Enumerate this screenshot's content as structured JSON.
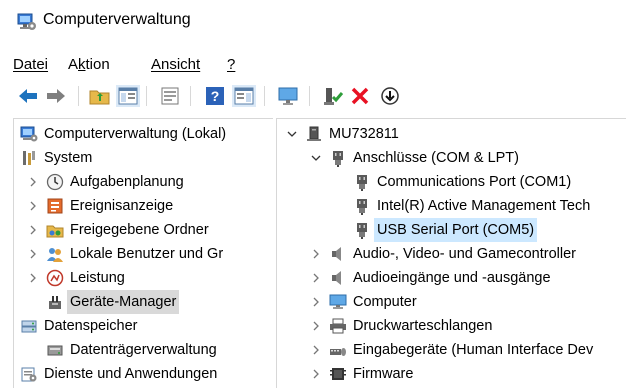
{
  "window": {
    "title": "Computerverwaltung"
  },
  "menu": [
    {
      "label": "Datei",
      "accel": "D"
    },
    {
      "label": "Aktion",
      "accel": "k"
    },
    {
      "label": "Ansicht",
      "accel": "A"
    },
    {
      "label": "?",
      "accel": "?"
    }
  ],
  "toolbar": [
    "back-arrow-icon",
    "forward-arrow-icon",
    "up-folder-icon",
    "show-hide-tree-icon",
    "properties-icon",
    "help-icon",
    "action-pane-icon",
    "monitor-icon",
    "enable-driver-icon",
    "delete-x-icon",
    "download-icon"
  ],
  "left_tree": [
    {
      "label": "Computerverwaltung (Lokal)",
      "level": 0,
      "chevron": "none",
      "icon": "computer-management-icon"
    },
    {
      "label": "System",
      "level": 0,
      "chevron": "open",
      "icon": "tools-icon"
    },
    {
      "label": "Aufgabenplanung",
      "level": 1,
      "chevron": "closed",
      "icon": "clock-icon"
    },
    {
      "label": "Ereignisanzeige",
      "level": 1,
      "chevron": "closed",
      "icon": "event-viewer-icon"
    },
    {
      "label": "Freigegebene Ordner",
      "level": 1,
      "chevron": "closed",
      "icon": "shared-folder-icon"
    },
    {
      "label": "Lokale Benutzer und Gr",
      "level": 1,
      "chevron": "closed",
      "icon": "users-icon"
    },
    {
      "label": "Leistung",
      "level": 1,
      "chevron": "closed",
      "icon": "performance-icon"
    },
    {
      "label": "Geräte-Manager",
      "level": 1,
      "chevron": "none",
      "icon": "device-manager-icon",
      "state": "gray"
    },
    {
      "label": "Datenspeicher",
      "level": 0,
      "chevron": "open",
      "icon": "storage-icon"
    },
    {
      "label": "Datenträgerverwaltung",
      "level": 1,
      "chevron": "none",
      "icon": "disk-management-icon"
    },
    {
      "label": "Dienste und Anwendungen",
      "level": 0,
      "chevron": "closed",
      "icon": "services-icon"
    }
  ],
  "right_tree": [
    {
      "label": "MU732811",
      "level": 0,
      "chevron": "open",
      "icon": "pc-icon"
    },
    {
      "label": "Anschlüsse (COM & LPT)",
      "level": 1,
      "chevron": "open",
      "icon": "port-icon"
    },
    {
      "label": "Communications Port (COM1)",
      "level": 2,
      "chevron": "none",
      "icon": "port-icon"
    },
    {
      "label": "Intel(R) Active Management Tech",
      "level": 2,
      "chevron": "none",
      "icon": "port-icon"
    },
    {
      "label": "USB Serial Port (COM5)",
      "level": 2,
      "chevron": "none",
      "icon": "port-icon",
      "state": "selected"
    },
    {
      "label": "Audio-, Video- und Gamecontroller",
      "level": 1,
      "chevron": "closed",
      "icon": "speaker-icon"
    },
    {
      "label": "Audioeingänge und -ausgänge",
      "level": 1,
      "chevron": "closed",
      "icon": "speaker-icon"
    },
    {
      "label": "Computer",
      "level": 1,
      "chevron": "closed",
      "icon": "monitor-icon"
    },
    {
      "label": "Druckwarteschlangen",
      "level": 1,
      "chevron": "closed",
      "icon": "printer-icon"
    },
    {
      "label": "Eingabegeräte (Human Interface Dev",
      "level": 1,
      "chevron": "closed",
      "icon": "hid-icon"
    },
    {
      "label": "Firmware",
      "level": 1,
      "chevron": "closed",
      "icon": "firmware-icon"
    }
  ],
  "colors": {
    "selection": "#cce8ff",
    "highlight_gray": "#d9d9d9",
    "accent_blue": "#1e73be",
    "delete_red": "#e81123"
  }
}
